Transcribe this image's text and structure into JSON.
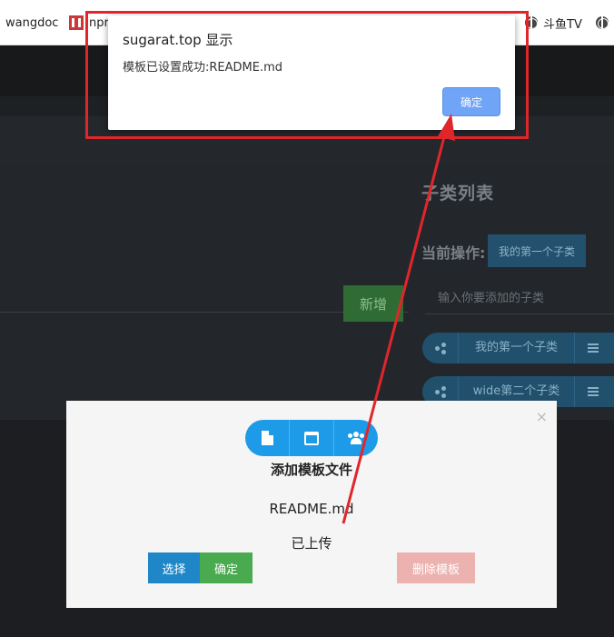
{
  "bookmarks": {
    "items": [
      {
        "label": "wangdoc"
      },
      {
        "label": "npr"
      },
      {
        "label": "斗鱼TV"
      }
    ]
  },
  "app": {
    "subcategory_title": "子类列表",
    "current_op_label": "当前操作:",
    "current_op_value": "我的第一个子类",
    "sub_input_placeholder": "输入你要添加的子类",
    "add_button": "新增",
    "subcategories": [
      {
        "label": "我的第一个子类"
      },
      {
        "label": "wide第二个子类"
      }
    ]
  },
  "alert": {
    "title": "sugarat.top 显示",
    "message": "模板已设置成功:README.md",
    "ok_label": "确定"
  },
  "modal": {
    "close": "×",
    "title": "添加模板文件",
    "filename": "README.md",
    "status": "已上传",
    "select_label": "选择",
    "confirm_label": "确定",
    "delete_label": "删除模板"
  },
  "colors": {
    "annotation": "#e0262b",
    "primary_blue": "#1e9be8",
    "confirm_green": "#4aaa4f",
    "danger_pink": "#ecb2b0",
    "alert_ok": "#6fa4f7"
  }
}
